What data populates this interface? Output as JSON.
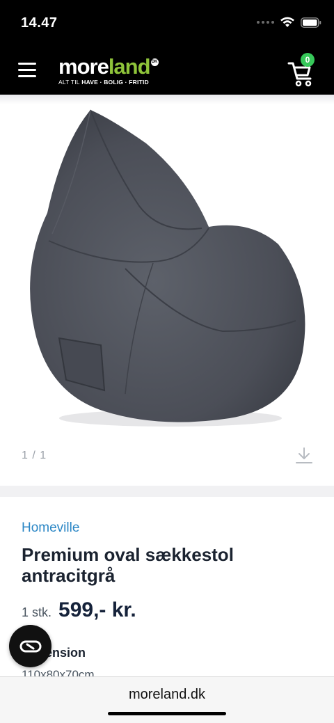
{
  "status": {
    "time": "14.47"
  },
  "header": {
    "logo": {
      "part1": "more",
      "part2": "land",
      "mark": "DK",
      "tag_light": "ALT TIL",
      "tag_bold": "HAVE · BOLIG · FRITID"
    },
    "cart_count": "0",
    "colors": {
      "background": "#000000",
      "logo_accent": "#8fc43a",
      "badge": "#37c85a"
    }
  },
  "gallery": {
    "counter": "1 / 1"
  },
  "product": {
    "brand": "Homeville",
    "title": "Premium oval sækkestol antracitgrå",
    "price_unit": "1 stk.",
    "price": "599,- kr.",
    "spec_label": "Dimension",
    "spec_value": "110x80x70cm",
    "colors": {
      "brand_link": "#2a86c5",
      "title": "#1b2330"
    }
  },
  "browser": {
    "url": "moreland.dk"
  }
}
